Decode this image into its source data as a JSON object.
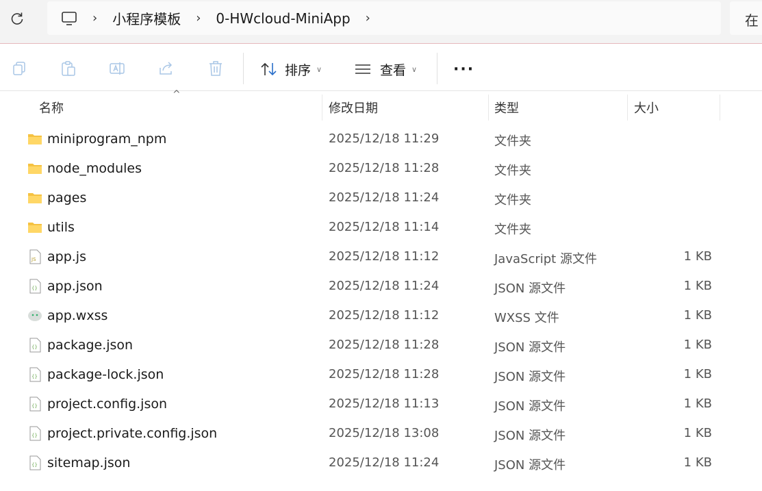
{
  "address_bar": {
    "breadcrumbs": [
      "小程序模板",
      "0-HWcloud-MiniApp"
    ],
    "search_text": "在"
  },
  "toolbar": {
    "sort_label": "排序",
    "view_label": "查看",
    "more_label": "···"
  },
  "columns": {
    "name": "名称",
    "date": "修改日期",
    "type": "类型",
    "size": "大小"
  },
  "files": [
    {
      "name": "miniprogram_npm",
      "date": "2025/12/18 11:29",
      "type": "文件夹",
      "size": "",
      "icon": "folder-icon"
    },
    {
      "name": "node_modules",
      "date": "2025/12/18 11:28",
      "type": "文件夹",
      "size": "",
      "icon": "folder-icon"
    },
    {
      "name": "pages",
      "date": "2025/12/18 11:24",
      "type": "文件夹",
      "size": "",
      "icon": "folder-icon"
    },
    {
      "name": "utils",
      "date": "2025/12/18 11:14",
      "type": "文件夹",
      "size": "",
      "icon": "folder-icon"
    },
    {
      "name": "app.js",
      "date": "2025/12/18 11:12",
      "type": "JavaScript 源文件",
      "size": "1 KB",
      "icon": "js-file-icon"
    },
    {
      "name": "app.json",
      "date": "2025/12/18 11:24",
      "type": "JSON 源文件",
      "size": "1 KB",
      "icon": "json-file-icon"
    },
    {
      "name": "app.wxss",
      "date": "2025/12/18 11:12",
      "type": "WXSS 文件",
      "size": "1 KB",
      "icon": "wxss-file-icon"
    },
    {
      "name": "package.json",
      "date": "2025/12/18 11:28",
      "type": "JSON 源文件",
      "size": "1 KB",
      "icon": "json-file-icon"
    },
    {
      "name": "package-lock.json",
      "date": "2025/12/18 11:28",
      "type": "JSON 源文件",
      "size": "1 KB",
      "icon": "json-file-icon"
    },
    {
      "name": "project.config.json",
      "date": "2025/12/18 11:13",
      "type": "JSON 源文件",
      "size": "1 KB",
      "icon": "json-file-icon"
    },
    {
      "name": "project.private.config.json",
      "date": "2025/12/18 13:08",
      "type": "JSON 源文件",
      "size": "1 KB",
      "icon": "json-file-icon"
    },
    {
      "name": "sitemap.json",
      "date": "2025/12/18 11:24",
      "type": "JSON 源文件",
      "size": "1 KB",
      "icon": "json-file-icon"
    }
  ]
}
